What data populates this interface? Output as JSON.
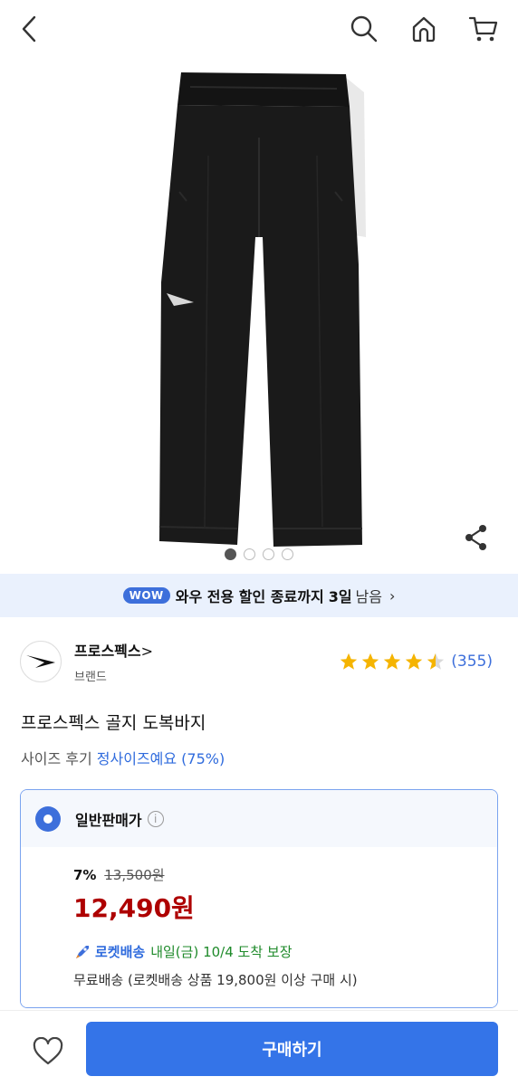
{
  "header": {
    "back_icon": "chevron-left-icon",
    "search_icon": "search-icon",
    "home_icon": "home-icon",
    "cart_icon": "cart-icon"
  },
  "gallery": {
    "image": "black track pants product photo",
    "page_count": 4,
    "active_page": 1
  },
  "wow_banner": {
    "badge": "WOW",
    "text": "와우 전용 할인 종료까지",
    "days": "3일",
    "remain": "남음",
    "arrow": "›"
  },
  "brand": {
    "name": "프로스펙스",
    "name_arrow": ">",
    "sub": "브랜드",
    "rating": 4.5,
    "review_count": "(355)"
  },
  "product": {
    "title": "프로스펙스 골지 도복바지",
    "size_review_label": "사이즈 후기",
    "size_review_value": "정사이즈예요 (75%)"
  },
  "price_option": {
    "label": "일반판매가",
    "info": "i",
    "discount_pct": "7%",
    "original_price": "13,500원",
    "sale_price": "12,490원",
    "rocket_name": "로켓배송",
    "rocket_eta": "내일(금) 10/4 도착 보장",
    "free_shipping": "무료배송 (로켓배송 상품 19,800원 이상 구매 시)"
  },
  "bottom": {
    "buy_label": "구매하기"
  },
  "colors": {
    "accent": "#3474e8",
    "sale": "#ae0000",
    "rocket_eta": "#1e8a2a",
    "wow_bg": "#eaf1fd",
    "star": "#f5b400"
  }
}
